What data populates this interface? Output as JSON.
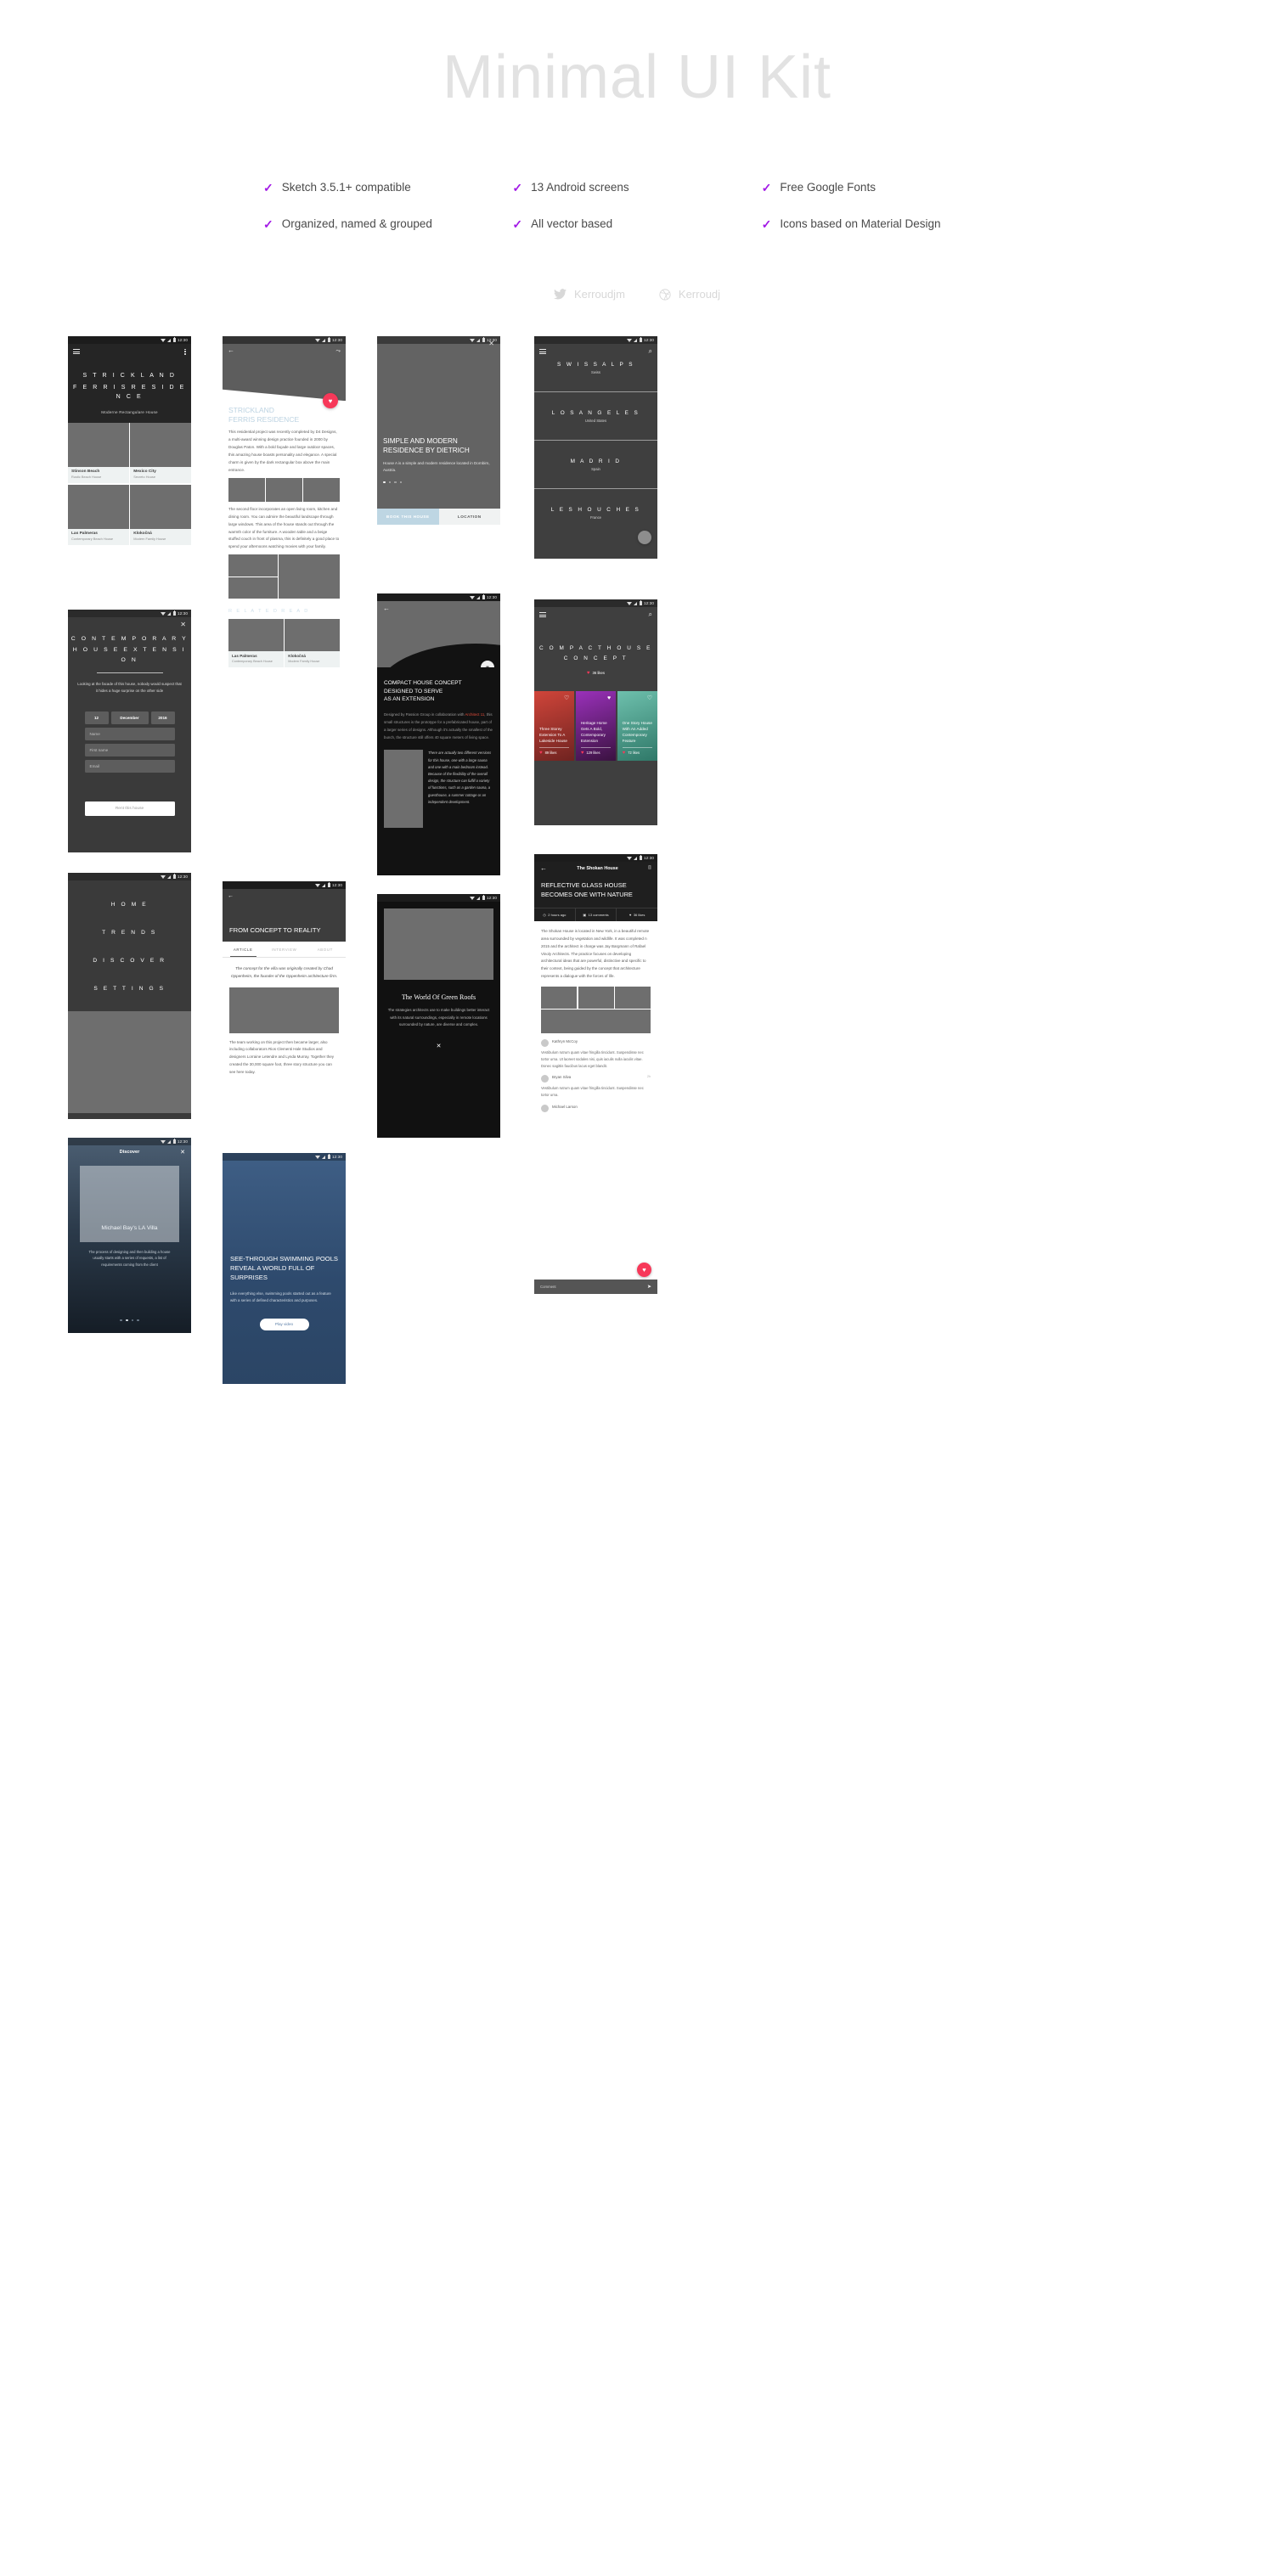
{
  "hero": {
    "title": "Minimal UI Kit",
    "features": [
      "Sketch 3.5.1+ compatible",
      "13 Android screens",
      "Free Google Fonts",
      "Organized, named & grouped",
      "All vector based",
      "Icons based on Material Design"
    ],
    "socials": [
      {
        "icon": "twitter-icon",
        "handle": "Kerroudjm"
      },
      {
        "icon": "dribbble-icon",
        "handle": "Kerroudj"
      }
    ],
    "accent_color": "#a219e6",
    "title_color": "#e2e2e2"
  },
  "statusbar": {
    "time": "12:30"
  },
  "screens": {
    "residence_list": {
      "title": "S T R I C K L A N D\nF E R R I S   R E S I D E N C E",
      "title_line1": "S T R I C K L A N D",
      "title_line2": "F E R R I S   R E S I D E N C E",
      "subtitle": "Moderne Rectangulare House",
      "menu_icon": "hamburger-icon",
      "overflow_icon": "more-vert-icon",
      "tiles": [
        {
          "name": "Stinson Beach",
          "desc": "Rustic Beach House"
        },
        {
          "name": "Mexico City",
          "desc": "Secreto House"
        },
        {
          "name": "Las Palmeras",
          "desc": "Contemporary Beach House"
        },
        {
          "name": "Klokočná",
          "desc": "Modern Family House"
        }
      ]
    },
    "booking_form": {
      "title_line1": "C O N T E M P O R A R Y",
      "title_line2": "H O U S E   E X T E N S I O N",
      "subtitle": "Looking at the facade of this house, nobody would suspect that it hides a huge surprise on the other side",
      "close_icon": "close-icon",
      "date": {
        "day": "12",
        "month": "December",
        "year": "2016"
      },
      "fields": [
        {
          "placeholder": "Name"
        },
        {
          "placeholder": "First name"
        },
        {
          "placeholder": "Email"
        }
      ],
      "cta": "Rent this house"
    },
    "nav_menu": {
      "items": [
        "H O M E",
        "T R E N D S",
        "D I S C O V E R",
        "S E T T I N G S"
      ]
    },
    "discover": {
      "title": "Discover",
      "close_icon": "close-icon",
      "card_title": "Michael Bay's LA Villa",
      "card_text": "The process of designing and then building a house usually starts with a series of requests, a list of requirements coming from the client",
      "dots": 4,
      "active_dot": 1
    },
    "article_strickland": {
      "back_icon": "arrow-back-icon",
      "share_icon": "share-icon",
      "fav_icon": "heart-icon",
      "fav_color": "#f73859",
      "title_line1": "STRICKLAND",
      "title_line2": "FERRIS RESIDENCE",
      "paragraph1": "This residential project was recently completed by D4 Designs, a multi-award winning design practice founded in 2000 by Douglas Paton. With a bold façade and large outdoor spaces, this amazing house boasts personality and elegance. A special charm is given by the dark rectangular box above the main entrance.",
      "paragraph2": "The second floor incorporates an open living room, kitchen and dining room. You can admire the beautiful landscape through large windows. This area of the house stands out through the warmth color of the furniture.  A wooden table and a beige stuffed couch in front of plasma, this is definitely a good place to spend your afternoons watching movies with your family.",
      "related_heading": "R E L A T E D   R E A D",
      "related": [
        {
          "name": "Las Palmeras",
          "desc": "Contemporary Beach House"
        },
        {
          "name": "Klokočná",
          "desc": "Modern Family House"
        }
      ]
    },
    "concept_to_reality": {
      "back_icon": "arrow-back-icon",
      "title": "FROM CONCEPT TO REALITY",
      "tabs": [
        "ARTICLE",
        "INTERVIEW",
        "ABOUT"
      ],
      "active_tab": "ARTICLE",
      "quote": "The concept for the villa was originally created by Chad Oppenheim, the founder of the Oppenheim architecture firm.",
      "paragraph": "The team working on this project then became larger, also including collaborators Rios Clementi Hale Studios and designers Lorraine Letendre and Lynda Murray. Together they created the 30,000 square foot, three story structure you can see here today."
    },
    "pools": {
      "title": "SEE-THROUGH SWIMMING POOLS REVEAL A WORLD FULL OF SURPRISES",
      "paragraph": "Like everything else, swimming pools started out as a feature with a series of defined characteristics and purposes.",
      "cta": "Play video"
    },
    "dietrich": {
      "close_icon": "close-icon",
      "title_line1": "SIMPLE AND MODERN",
      "title_line2": "RESIDENCE BY DIETRICH",
      "subtitle": "House A is a simple and modern residence located in Dornbirn, Austria.",
      "dots": 4,
      "active_dot": 1,
      "buttons": [
        "BOOK THIS HOUSE",
        "LOCATION"
      ]
    },
    "compact_house_article": {
      "back_icon": "arrow-back-icon",
      "badge_icon": "camera-icon",
      "title_line1": "COMPACT HOUSE CONCEPT",
      "title_line2": "DESIGNED TO SERVE",
      "title_line3": "AS AN EXTENSION",
      "paragraph_pre": "Designed by Passion Group in collaboration with ",
      "paragraph_link": "Architect 11",
      "paragraph_post": ", this small structures is the prototype for a prefabricated house, part of a larger series of designs. Although it's actually the smallest of the bunch, the structure still offers 40 square meters of living space.",
      "link_color": "#e04b3a",
      "quote": "There are actually two different versions for this house, one with a large sauna and one with a main bedroom instead. Because of the flexibility of the overall design, the structure can fulfill a variety of functions, such as a garden sauna, a guesthouse, a summer cottage or an independent development."
    },
    "green_roofs": {
      "title": "The World Of Green Roofs",
      "paragraph": "The strategies architects use to make buildings better interact with its natural surroundings, especially in remote locations surrounded by nature, are diverse and complex.",
      "close_icon": "close-icon"
    },
    "locations": {
      "menu_icon": "hamburger-icon",
      "search_icon": "search-icon",
      "items": [
        {
          "name": "S W I S S   A L P S",
          "country": "Swiss"
        },
        {
          "name": "L O S   A N G E L E S",
          "country": "United States"
        },
        {
          "name": "M A D R I D",
          "country": "Spain"
        },
        {
          "name": "L E S   H O U C H E S",
          "country": "France"
        }
      ]
    },
    "compact_cards": {
      "menu_icon": "hamburger-icon",
      "search_icon": "search-icon",
      "title_line1": "C O M P A C T   H O U S E",
      "title_line2": "C O N C E P T",
      "likes": "36 likes",
      "cards": [
        {
          "title": "Three Storey Extension To A Lakeside House",
          "likes": "89 likes",
          "color": "#d0453a",
          "bookmark": "bookmark-outline-icon"
        },
        {
          "title": "Heritage Home Gets A Bold, Contemporary Extension",
          "likes": "129 likes",
          "color": "#9a31ba",
          "bookmark": "bookmark-filled-icon"
        },
        {
          "title": "One Story House With An Added Contemporary Feature",
          "likes": "72 likes",
          "color": "#6ec0ad",
          "bookmark": "bookmark-outline-icon"
        }
      ]
    },
    "shokan": {
      "back_icon": "arrow-back-icon",
      "appbar_title": "The Shokan House",
      "bookmark_icon": "bookmark-outline-icon",
      "title": "REFLECTIVE GLASS HOUSE BECOMES ONE WITH NATURE",
      "meta": [
        {
          "icon": "clock-icon",
          "label": "2 hours ago"
        },
        {
          "icon": "comment-icon",
          "label": "13 comments"
        },
        {
          "icon": "heart-icon",
          "label": "36 likes"
        }
      ],
      "paragraph": "The Shokan House is located in New York, in a beautiful remote area surrounded by vegetation and wildlife. It was completed n 2015 and the architect in charge was Jay Bargmann of Rafael Vinoly Architects. The practice focuses on developing architectural ideas that are powerful, distinctive and specific to their context, being guided by the concept that architecture represents a dialogue with the forces of life.",
      "comments": [
        {
          "name": "Kathryn McCoy",
          "time": "",
          "body": "Vestibulum rutrum quam vitae fringilla tincidunt. Suspendisse nec tortor urna. Ut laoreet sodales nisi, quis iaculis nulla iaculis vitae. Donec sagittis faucibus lacus eget blandit."
        },
        {
          "name": "Bryan Silva",
          "time": "2h",
          "body": "Vestibulum rutrum quam vitae fringilla tincidunt. Suspendisse nec tortor urna."
        },
        {
          "name": "Michael Larson",
          "time": "",
          "body": ""
        }
      ],
      "comment_placeholder": "Comment",
      "send_icon": "send-icon",
      "fav_icon": "heart-icon"
    }
  }
}
